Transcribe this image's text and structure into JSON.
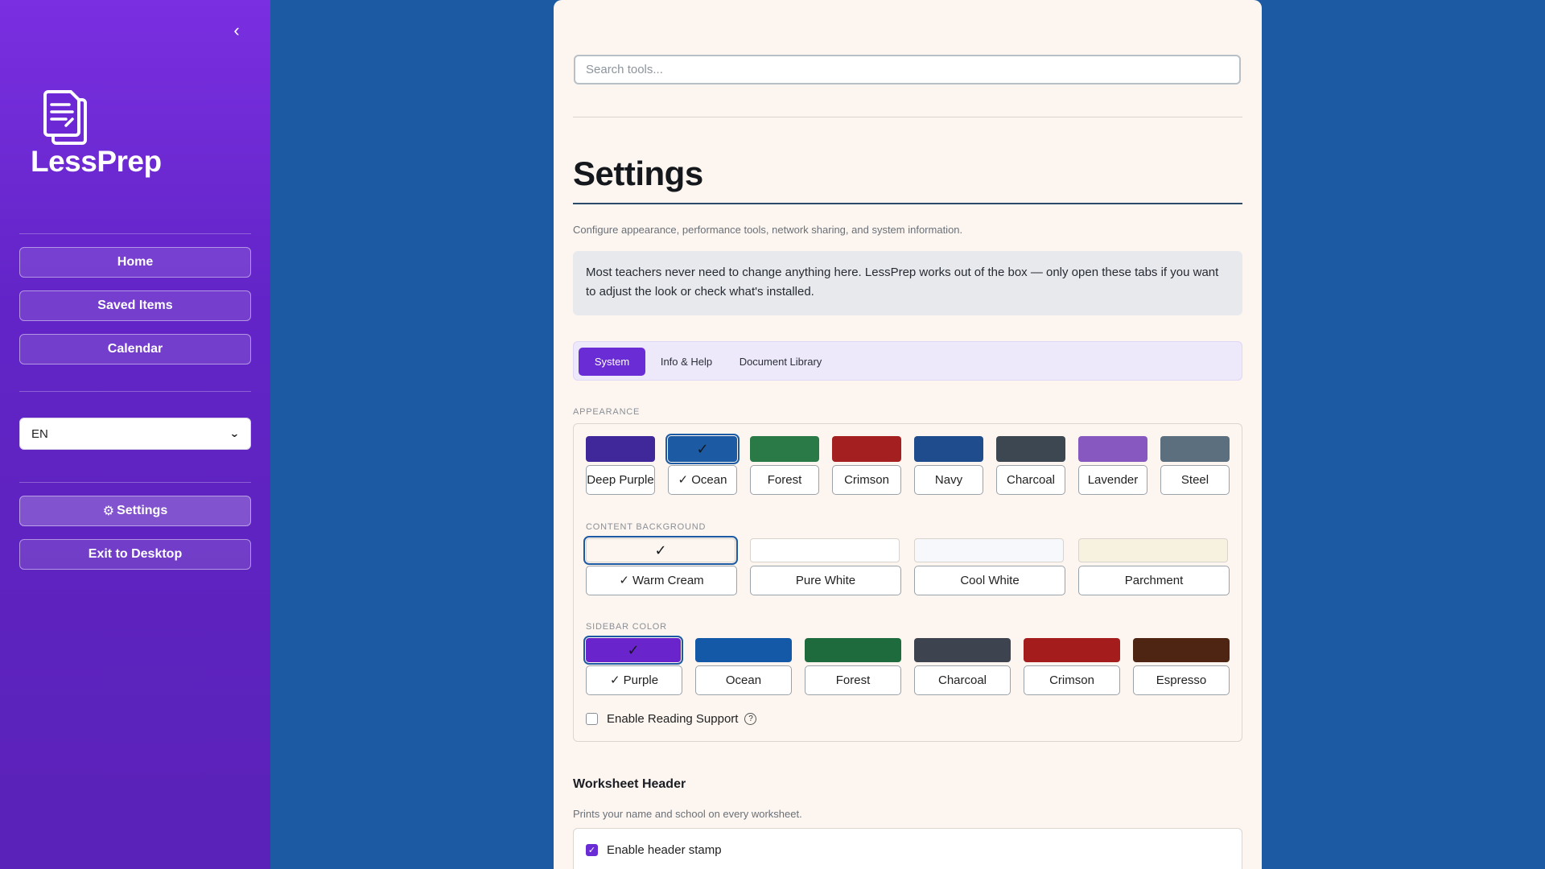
{
  "sidebar": {
    "collapse_icon": "chevron-left-icon",
    "logo_text": "LessPrep",
    "nav": {
      "home": "Home",
      "saved": "Saved Items",
      "calendar": "Calendar"
    },
    "language": "EN",
    "settings_icon": "⚙",
    "settings": "Settings",
    "exit": "Exit to Desktop"
  },
  "main": {
    "search_placeholder": "Search tools...",
    "title": "Settings",
    "subtitle": "Configure appearance, performance tools, network sharing, and system information.",
    "info": "Most teachers never need to change anything here. LessPrep works out of the box — only open these tabs if you want to adjust the look or check what's installed.",
    "tabs": {
      "system": "System",
      "info_help": "Info & Help",
      "doc_library": "Document Library"
    },
    "active_tab": "System"
  },
  "appearance": {
    "label": "APPEARANCE",
    "checkmark": "✓",
    "themes": [
      {
        "label": "Deep Purple",
        "color": "#41289a"
      },
      {
        "label": "✓ Ocean",
        "color": "#1c5ba3",
        "selected": true
      },
      {
        "label": "Forest",
        "color": "#2a7a48"
      },
      {
        "label": "Crimson",
        "color": "#a42020"
      },
      {
        "label": "Navy",
        "color": "#1e4c8c"
      },
      {
        "label": "Charcoal",
        "color": "#3c4751"
      },
      {
        "label": "Lavender",
        "color": "#8658c0"
      },
      {
        "label": "Steel",
        "color": "#5c6f7e"
      }
    ],
    "content_background_label": "CONTENT BACKGROUND",
    "backgrounds": [
      {
        "label": "✓ Warm Cream",
        "color": "#fdf6f0",
        "selected": true
      },
      {
        "label": "Pure White",
        "color": "#ffffff"
      },
      {
        "label": "Cool White",
        "color": "#f6f8fb"
      },
      {
        "label": "Parchment",
        "color": "#f6f2df"
      }
    ],
    "sidebar_color_label": "SIDEBAR COLOR",
    "sidebar_colors": [
      {
        "label": "✓ Purple",
        "color": "#6a24cc",
        "selected": true
      },
      {
        "label": "Ocean",
        "color": "#1458a8"
      },
      {
        "label": "Forest",
        "color": "#1e6b3e"
      },
      {
        "label": "Charcoal",
        "color": "#3d4450"
      },
      {
        "label": "Crimson",
        "color": "#a41c1c"
      },
      {
        "label": "Espresso",
        "color": "#4e2412"
      }
    ],
    "reading_support": "Enable Reading Support",
    "reading_support_checked": false,
    "help_glyph": "?"
  },
  "worksheet_header": {
    "title": "Worksheet Header",
    "description": "Prints your name and school on every worksheet.",
    "stamp_label": "Enable header stamp",
    "stamp_checked": true,
    "stamp_check_glyph": "✓"
  }
}
